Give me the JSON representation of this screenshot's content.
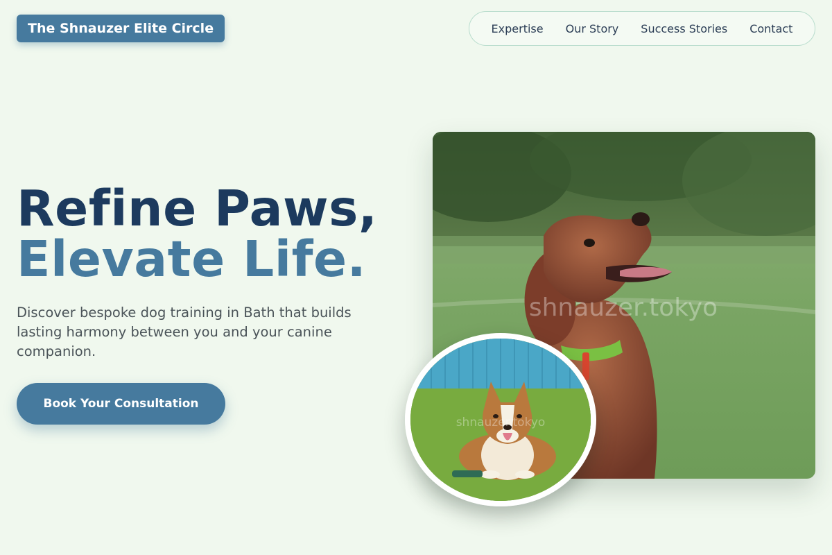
{
  "header": {
    "logo_text": "The Shnauzer Elite Circle",
    "nav": [
      "Expertise",
      "Our Story",
      "Success Stories",
      "Contact"
    ]
  },
  "hero": {
    "headline_line1": "Refine Paws,",
    "headline_line2": "Elevate Life.",
    "description": "Discover bespoke dog training in Bath that builds lasting harmony between you and your canine companion.",
    "cta_label": "Book Your Consultation"
  },
  "images": {
    "main_watermark": "shnauzer.tokyo",
    "circle_watermark": "shnauzer.tokyo"
  },
  "colors": {
    "background": "#f0f8ee",
    "primary": "#467a9e",
    "headline_dark": "#1c3a5e"
  }
}
